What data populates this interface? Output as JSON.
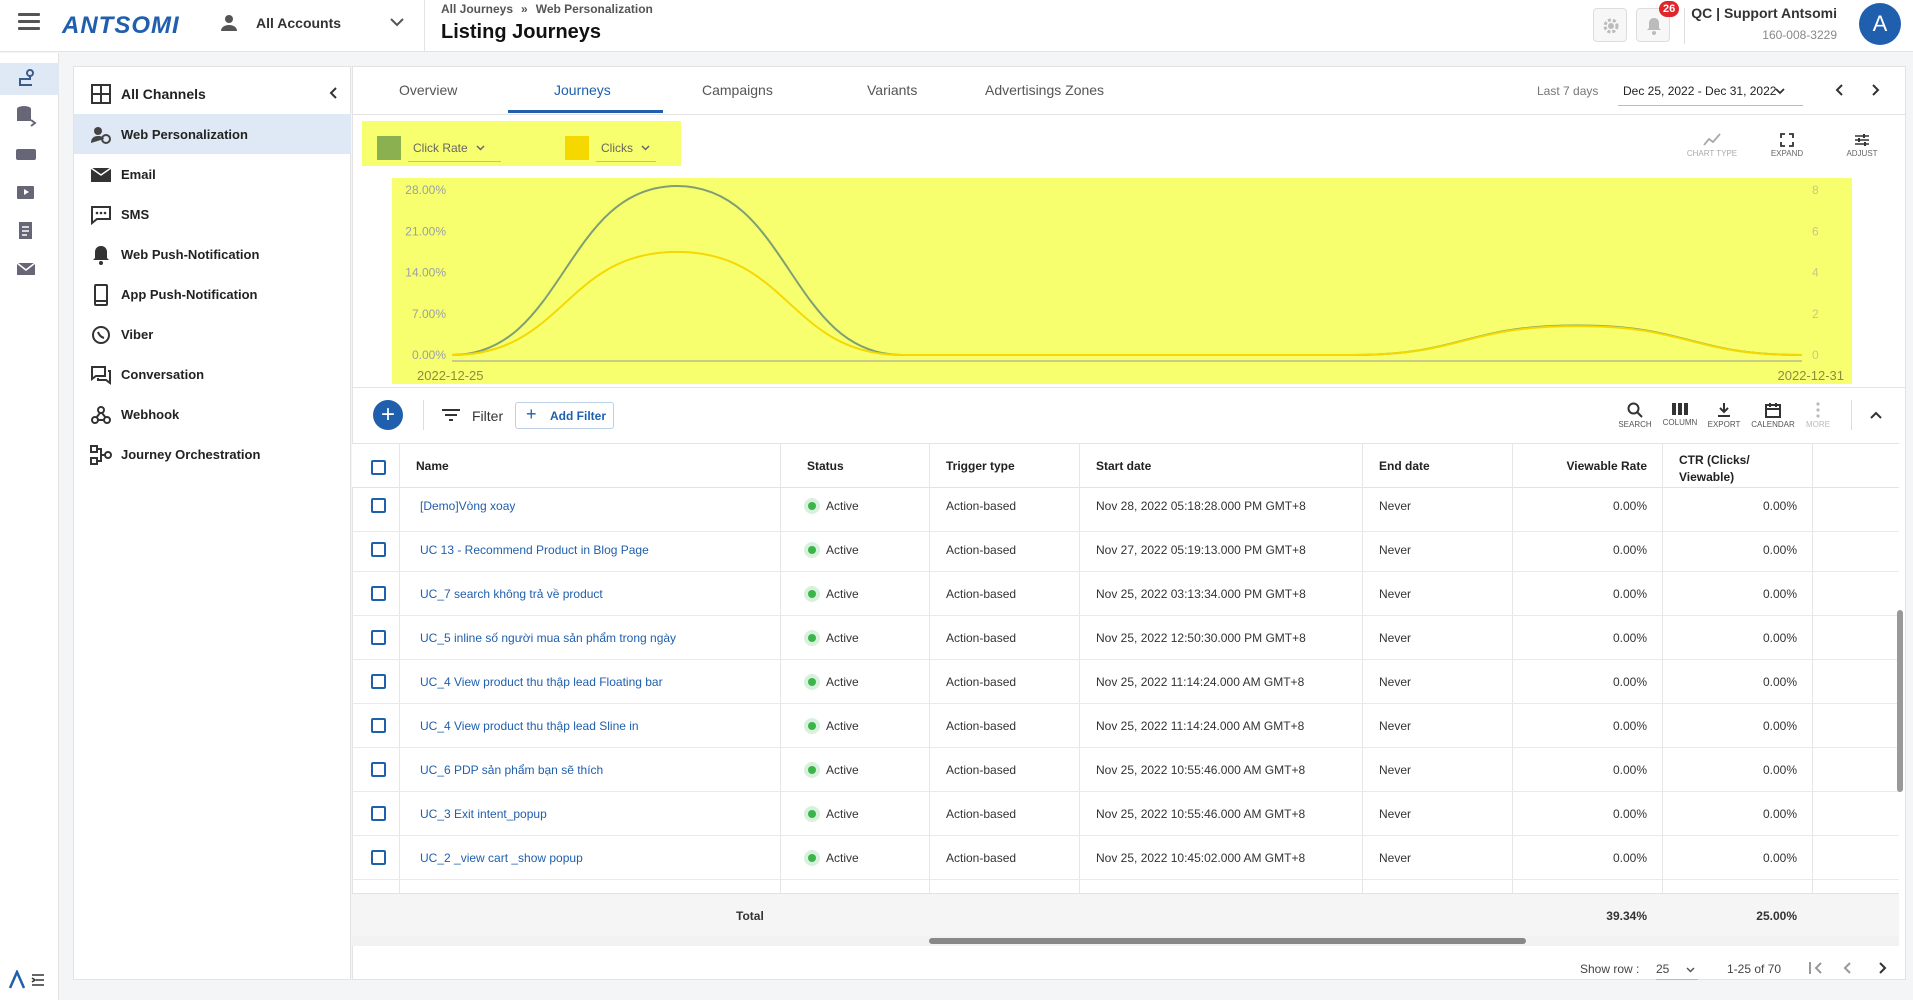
{
  "topbar": {
    "logo": "ANTSOMI",
    "account_label": "All Accounts",
    "breadcrumb": [
      "All Journeys",
      "Web Personalization"
    ],
    "breadcrumb_sep": "»",
    "page_title": "Listing Journeys",
    "notification_count": "26",
    "user_name": "QC | Support Antsomi",
    "user_id": "160-008-3229",
    "avatar_letter": "A"
  },
  "channels": {
    "header": "All Channels",
    "items": [
      {
        "label": "Web Personalization",
        "icon": "web-personalization-icon",
        "active": true
      },
      {
        "label": "Email",
        "icon": "email-icon"
      },
      {
        "label": "SMS",
        "icon": "sms-icon"
      },
      {
        "label": "Web Push-Notification",
        "icon": "bell-icon"
      },
      {
        "label": "App Push-Notification",
        "icon": "phone-icon"
      },
      {
        "label": "Viber",
        "icon": "viber-icon"
      },
      {
        "label": "Conversation",
        "icon": "chat-icon"
      },
      {
        "label": "Webhook",
        "icon": "webhook-icon"
      },
      {
        "label": "Journey Orchestration",
        "icon": "orchestration-icon"
      }
    ]
  },
  "tabs": [
    "Overview",
    "Journeys",
    "Campaigns",
    "Variants",
    "Advertisings Zones"
  ],
  "active_tab": "Journeys",
  "date": {
    "label": "Last 7 days",
    "range": "Dec 25, 2022 - Dec 31, 2022"
  },
  "legend": {
    "metric1": "Click Rate",
    "metric2": "Clicks",
    "color1": "#8bb04f",
    "color2": "#f5d800"
  },
  "chart_tools": [
    "CHART TYPE",
    "EXPAND",
    "ADJUST"
  ],
  "chart_data": {
    "type": "line",
    "x": [
      "2022-12-25",
      "2022-12-26",
      "2022-12-27",
      "2022-12-28",
      "2022-12-29",
      "2022-12-30",
      "2022-12-31"
    ],
    "x_tick_labels": [
      "2022-12-25",
      "2022-12-31"
    ],
    "y_left_ticks": [
      "28.00%",
      "21.00%",
      "14.00%",
      "7.00%",
      "0.00%"
    ],
    "y_right_ticks": [
      "8",
      "6",
      "4",
      "2",
      "0"
    ],
    "ylim_left": [
      0,
      28
    ],
    "ylim_right": [
      0,
      8
    ],
    "series": [
      {
        "name": "Click Rate",
        "axis": "left",
        "values": [
          0,
          29,
          0,
          0,
          0,
          5,
          0
        ]
      },
      {
        "name": "Clicks",
        "axis": "right",
        "values": [
          0,
          5,
          0,
          0,
          0,
          1.4,
          0
        ]
      }
    ],
    "background": "#f7ff6f"
  },
  "toolbar": {
    "filter_label": "Filter",
    "add_filter_label": "Add Filter",
    "tools": [
      "SEARCH",
      "COLUMN",
      "EXPORT",
      "CALENDAR",
      "MORE"
    ]
  },
  "table": {
    "headers": {
      "name": "Name",
      "status": "Status",
      "trigger": "Trigger type",
      "start": "Start date",
      "end": "End date",
      "viewable_rate": "Viewable Rate",
      "ctr": "CTR (Clicks/ Viewable)"
    },
    "rows": [
      {
        "name": "[Demo]Vòng xoay",
        "status": "Active",
        "trigger": "Action-based",
        "start": "Nov 28, 2022 05:18:28.000 PM GMT+8",
        "end": "Never",
        "viewable_rate": "0.00%",
        "ctr": "0.00%"
      },
      {
        "name": "UC 13 - Recommend Product in Blog Page",
        "status": "Active",
        "trigger": "Action-based",
        "start": "Nov 27, 2022 05:19:13.000 PM GMT+8",
        "end": "Never",
        "viewable_rate": "0.00%",
        "ctr": "0.00%"
      },
      {
        "name": "UC_7 search không trả về product",
        "status": "Active",
        "trigger": "Action-based",
        "start": "Nov 25, 2022 03:13:34.000 PM GMT+8",
        "end": "Never",
        "viewable_rate": "0.00%",
        "ctr": "0.00%"
      },
      {
        "name": "UC_5 inline số người mua sản phẩm trong ngày",
        "status": "Active",
        "trigger": "Action-based",
        "start": "Nov 25, 2022 12:50:30.000 PM GMT+8",
        "end": "Never",
        "viewable_rate": "0.00%",
        "ctr": "0.00%"
      },
      {
        "name": "UC_4 View product thu thập lead Floating bar",
        "status": "Active",
        "trigger": "Action-based",
        "start": "Nov 25, 2022 11:14:24.000 AM GMT+8",
        "end": "Never",
        "viewable_rate": "0.00%",
        "ctr": "0.00%"
      },
      {
        "name": "UC_4 View product thu thập lead Sline in",
        "status": "Active",
        "trigger": "Action-based",
        "start": "Nov 25, 2022 11:14:24.000 AM GMT+8",
        "end": "Never",
        "viewable_rate": "0.00%",
        "ctr": "0.00%"
      },
      {
        "name": "UC_6 PDP sản phẩm bạn sẽ thích",
        "status": "Active",
        "trigger": "Action-based",
        "start": "Nov 25, 2022 10:55:46.000 AM GMT+8",
        "end": "Never",
        "viewable_rate": "0.00%",
        "ctr": "0.00%"
      },
      {
        "name": "UC_3 Exit intent_popup",
        "status": "Active",
        "trigger": "Action-based",
        "start": "Nov 25, 2022 10:55:46.000 AM GMT+8",
        "end": "Never",
        "viewable_rate": "0.00%",
        "ctr": "0.00%"
      },
      {
        "name": "UC_2 _view cart _show popup",
        "status": "Active",
        "trigger": "Action-based",
        "start": "Nov 25, 2022 10:45:02.000 AM GMT+8",
        "end": "Never",
        "viewable_rate": "0.00%",
        "ctr": "0.00%"
      }
    ],
    "total": {
      "label": "Total",
      "viewable_rate": "39.34%",
      "ctr": "25.00%"
    }
  },
  "footer": {
    "show_row_label": "Show row :",
    "show_row_value": "25",
    "page_info": "1-25 of 70"
  }
}
